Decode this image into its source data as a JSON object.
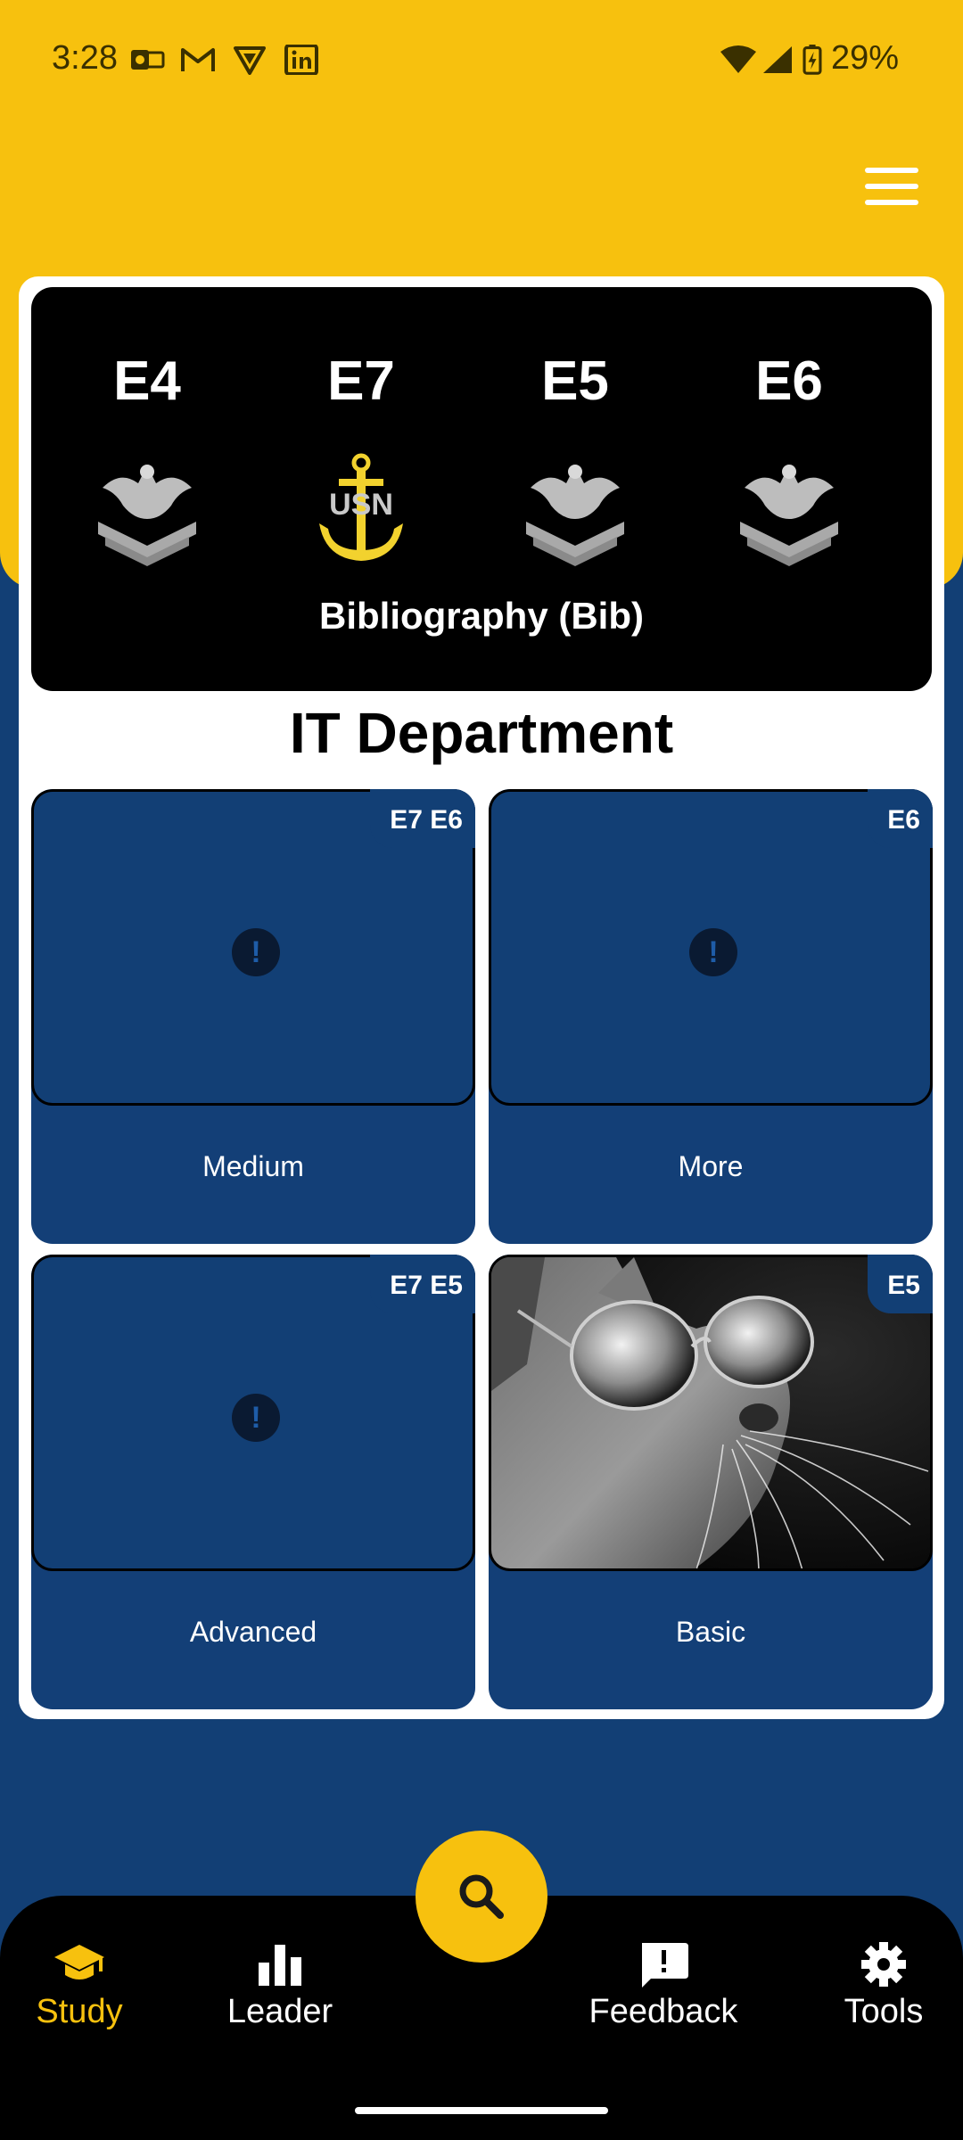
{
  "status_bar": {
    "time": "3:28",
    "battery": "29%",
    "notification_icons": [
      "outlook-icon",
      "gmail-icon",
      "proton-vpn-icon",
      "linkedin-icon"
    ],
    "system_icons": [
      "wifi-icon",
      "cell-signal-icon",
      "battery-charging-icon"
    ]
  },
  "header": {
    "menu_icon": "hamburger-menu-icon"
  },
  "hero": {
    "ranks": [
      "E4",
      "E7",
      "E5",
      "E6"
    ],
    "insignia_icons": [
      "petty-officer-eagle-chevron-icon",
      "chief-anchor-usn-icon",
      "petty-officer-eagle-chevron-icon",
      "petty-officer-eagle-chevron-icon"
    ],
    "subtitle": "Bibliography (Bib)"
  },
  "department": {
    "title": "IT Department"
  },
  "tiles": [
    {
      "badge": "E7 E6",
      "label": "Medium",
      "media": "alert-placeholder"
    },
    {
      "badge": "E6",
      "label": "More",
      "media": "alert-placeholder"
    },
    {
      "badge": "E7 E5",
      "label": "Advanced",
      "media": "alert-placeholder"
    },
    {
      "badge": "E5",
      "label": "Basic",
      "media": "cat-with-sunglasses-photo"
    }
  ],
  "fab": {
    "icon": "search-icon"
  },
  "bottom_nav": {
    "items": [
      {
        "label": "Study",
        "icon": "graduation-cap-icon",
        "active": true
      },
      {
        "label": "Leader",
        "icon": "bar-chart-icon",
        "active": false
      },
      {
        "label": "Feedback",
        "icon": "feedback-icon",
        "active": false
      },
      {
        "label": "Tools",
        "icon": "gear-icon",
        "active": false
      }
    ]
  },
  "colors": {
    "accent_yellow": "#F7C10E",
    "navy": "#123F75",
    "black": "#000000",
    "white": "#FFFFFF"
  }
}
